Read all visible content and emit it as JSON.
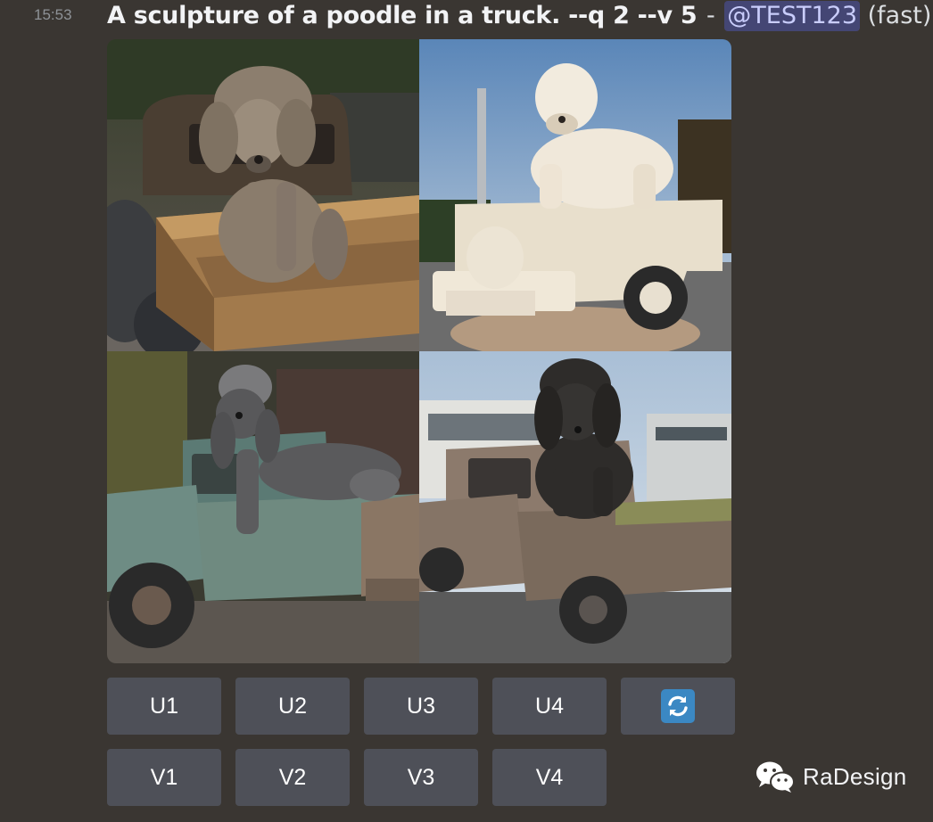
{
  "message": {
    "timestamp": "15:53",
    "prompt": "A sculpture of a poodle in a truck. --q 2 --v 5",
    "separator": "-",
    "mention": "@TEST123",
    "mode": "(fast)"
  },
  "images": [
    {
      "position": "top-left"
    },
    {
      "position": "top-right"
    },
    {
      "position": "bottom-left"
    },
    {
      "position": "bottom-right"
    }
  ],
  "buttons": {
    "upscale": [
      "U1",
      "U2",
      "U3",
      "U4"
    ],
    "variation": [
      "V1",
      "V2",
      "V3",
      "V4"
    ],
    "reroll_icon": "reroll-icon"
  },
  "watermark": {
    "icon": "wechat-icon",
    "text": "RaDesign"
  },
  "colors": {
    "background": "#3a3632",
    "button": "#4e5058",
    "mention_bg": "#5865f2",
    "reroll_blue": "#3b88c3"
  }
}
